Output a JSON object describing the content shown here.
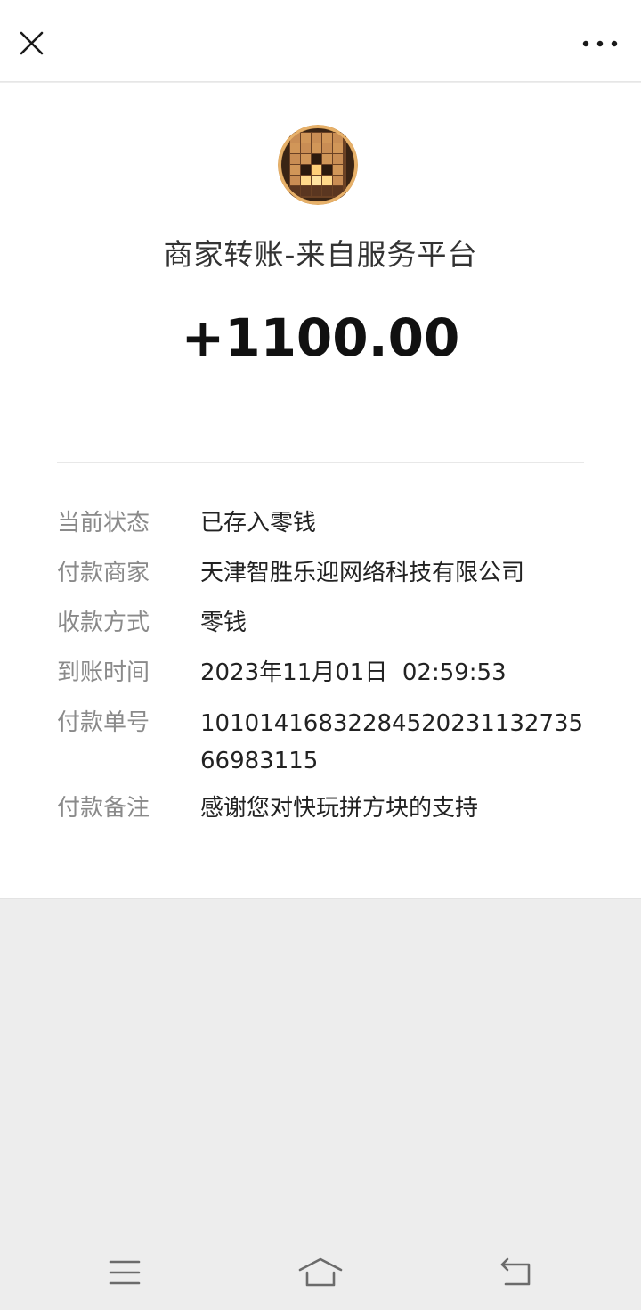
{
  "header": {
    "close_icon": "close-icon",
    "more_icon": "more-dots-icon"
  },
  "merchant": {
    "avatar_icon": "wood-block-puzzle-logo",
    "title": "商家转账-来自服务平台",
    "amount": "+1100.00"
  },
  "details": {
    "rows": [
      {
        "label": "当前状态",
        "value": "已存入零钱"
      },
      {
        "label": "付款商家",
        "value": "天津智胜乐迎网络科技有限公司"
      },
      {
        "label": "收款方式",
        "value": "零钱"
      },
      {
        "label": "到账时间",
        "value": "2023年11月01日  02:59:53"
      },
      {
        "label": "付款单号",
        "value": "1010141683228452023113273566983115"
      },
      {
        "label": "付款备注",
        "value": "感谢您对快玩拼方块的支持"
      }
    ]
  },
  "navbar": {
    "menu_icon": "menu-icon",
    "home_icon": "home-icon",
    "back_icon": "back-icon"
  },
  "colors": {
    "page_bg": "#ededed",
    "card_bg": "#ffffff",
    "label_gray": "#8a8a8a",
    "text_dark": "#222222"
  }
}
